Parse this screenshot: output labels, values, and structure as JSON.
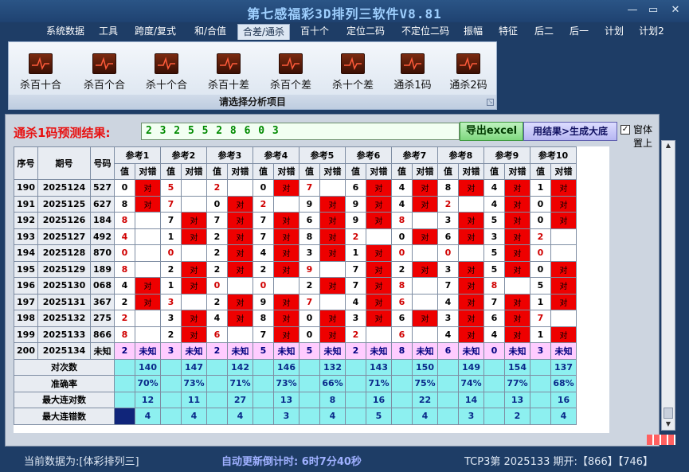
{
  "window": {
    "title": "第七感福彩3D排列三软件V8.81",
    "btn_min": "—",
    "btn_max": "▭",
    "btn_close": "✕"
  },
  "menu": [
    "系统数据",
    "工具",
    "跨度/复式",
    "和/合值",
    "合差/通杀",
    "百十个",
    "定位二码",
    "不定位二码",
    "振幅",
    "特征",
    "后二",
    "后一",
    "计划",
    "计划2"
  ],
  "ribbon": {
    "buttons": [
      "杀百十合",
      "杀百个合",
      "杀十个合",
      "杀百十差",
      "杀百个差",
      "杀十个差",
      "通杀1码",
      "通杀2码"
    ],
    "caption": "请选择分析项目"
  },
  "prediction": {
    "label": "通杀1码预测结果:",
    "value": "2 3 2 5 5 2 8 6 0 3",
    "excel_button": "导出excel",
    "generate_button": "用结果>生成大底",
    "pin_checkbox": "窗体置上",
    "pin_checked": true
  },
  "grid": {
    "h_seq": "序号",
    "h_period": "期号",
    "h_number": "号码",
    "refs": [
      "参考1",
      "参考2",
      "参考3",
      "参考4",
      "参考5",
      "参考6",
      "参考7",
      "参考8",
      "参考9",
      "参考10"
    ],
    "sub_value": "值",
    "sub_result": "对错",
    "ok_text": "对",
    "unknown_text": "未知",
    "rows": [
      {
        "seq": "190",
        "period": "2025124",
        "num": "527",
        "vals": [
          "0",
          "5",
          "2",
          "0",
          "7",
          "6",
          "4",
          "8",
          "4",
          "1"
        ],
        "ok": [
          1,
          0,
          0,
          1,
          0,
          1,
          1,
          1,
          1,
          1
        ],
        "red": [
          0,
          1,
          1,
          0,
          1,
          0,
          0,
          0,
          0,
          0
        ]
      },
      {
        "seq": "191",
        "period": "2025125",
        "num": "627",
        "vals": [
          "8",
          "7",
          "0",
          "2",
          "9",
          "9",
          "4",
          "2",
          "4",
          "0"
        ],
        "ok": [
          1,
          0,
          1,
          0,
          1,
          1,
          1,
          0,
          1,
          1
        ],
        "red": [
          0,
          1,
          0,
          1,
          0,
          0,
          0,
          1,
          0,
          0
        ]
      },
      {
        "seq": "192",
        "period": "2025126",
        "num": "184",
        "vals": [
          "8",
          "7",
          "7",
          "7",
          "6",
          "9",
          "8",
          "3",
          "5",
          "0"
        ],
        "ok": [
          0,
          1,
          1,
          1,
          1,
          1,
          0,
          1,
          1,
          1
        ],
        "red": [
          1,
          0,
          0,
          0,
          0,
          0,
          1,
          0,
          0,
          0
        ]
      },
      {
        "seq": "193",
        "period": "2025127",
        "num": "492",
        "vals": [
          "4",
          "1",
          "2",
          "7",
          "8",
          "2",
          "0",
          "6",
          "3",
          "2"
        ],
        "ok": [
          0,
          1,
          1,
          1,
          1,
          0,
          1,
          1,
          1,
          0
        ],
        "red": [
          1,
          0,
          0,
          0,
          0,
          1,
          0,
          0,
          0,
          1
        ]
      },
      {
        "seq": "194",
        "period": "2025128",
        "num": "870",
        "vals": [
          "0",
          "0",
          "2",
          "4",
          "3",
          "1",
          "0",
          "0",
          "5",
          "0"
        ],
        "ok": [
          0,
          0,
          1,
          1,
          1,
          1,
          0,
          0,
          1,
          0
        ],
        "red": [
          1,
          1,
          0,
          0,
          0,
          0,
          1,
          1,
          0,
          1
        ]
      },
      {
        "seq": "195",
        "period": "2025129",
        "num": "189",
        "vals": [
          "8",
          "2",
          "2",
          "2",
          "9",
          "7",
          "2",
          "3",
          "5",
          "0"
        ],
        "ok": [
          0,
          1,
          1,
          1,
          0,
          1,
          1,
          1,
          1,
          1
        ],
        "red": [
          1,
          0,
          0,
          0,
          1,
          0,
          0,
          0,
          0,
          0
        ]
      },
      {
        "seq": "196",
        "period": "2025130",
        "num": "068",
        "vals": [
          "4",
          "1",
          "0",
          "0",
          "2",
          "7",
          "8",
          "7",
          "8",
          "5"
        ],
        "ok": [
          1,
          1,
          0,
          0,
          1,
          1,
          0,
          1,
          0,
          1
        ],
        "red": [
          0,
          0,
          1,
          1,
          0,
          0,
          1,
          0,
          1,
          0
        ]
      },
      {
        "seq": "197",
        "period": "2025131",
        "num": "367",
        "vals": [
          "2",
          "3",
          "2",
          "9",
          "7",
          "4",
          "6",
          "4",
          "7",
          "1"
        ],
        "ok": [
          1,
          0,
          1,
          1,
          0,
          1,
          0,
          1,
          1,
          1
        ],
        "red": [
          0,
          1,
          0,
          0,
          1,
          0,
          1,
          0,
          0,
          0
        ]
      },
      {
        "seq": "198",
        "period": "2025132",
        "num": "275",
        "vals": [
          "2",
          "3",
          "4",
          "8",
          "0",
          "3",
          "6",
          "3",
          "6",
          "7"
        ],
        "ok": [
          0,
          1,
          1,
          1,
          1,
          1,
          1,
          1,
          1,
          0
        ],
        "red": [
          1,
          0,
          0,
          0,
          0,
          0,
          0,
          0,
          0,
          1
        ]
      },
      {
        "seq": "199",
        "period": "2025133",
        "num": "866",
        "vals": [
          "8",
          "2",
          "6",
          "7",
          "0",
          "2",
          "6",
          "4",
          "4",
          "1"
        ],
        "ok": [
          0,
          1,
          0,
          1,
          1,
          0,
          0,
          1,
          1,
          1
        ],
        "red": [
          1,
          0,
          1,
          0,
          0,
          1,
          1,
          0,
          0,
          0
        ]
      }
    ],
    "pred_row": {
      "seq": "200",
      "period": "2025134",
      "num": "未知",
      "vals": [
        "2",
        "3",
        "2",
        "5",
        "5",
        "2",
        "8",
        "6",
        "0",
        "3"
      ]
    },
    "stats": [
      {
        "label": "对次数",
        "vals": [
          "140",
          "147",
          "142",
          "146",
          "132",
          "143",
          "150",
          "149",
          "154",
          "137"
        ]
      },
      {
        "label": "准确率",
        "vals": [
          "70%",
          "73%",
          "71%",
          "73%",
          "66%",
          "71%",
          "75%",
          "74%",
          "77%",
          "68%"
        ]
      },
      {
        "label": "最大连对数",
        "vals": [
          "12",
          "11",
          "27",
          "13",
          "8",
          "16",
          "22",
          "14",
          "13",
          "16"
        ]
      },
      {
        "label": "最大连错数",
        "vals": [
          "4",
          "4",
          "4",
          "3",
          "4",
          "5",
          "4",
          "3",
          "2",
          "4"
        ]
      }
    ]
  },
  "status": {
    "current_data": "当前数据为:[体彩排列三]",
    "countdown": "自动更新倒计时: 6时7分40秒",
    "last_draw": "TCP3第 2025133 期开:【866】【746】"
  },
  "colors": {
    "hit_red": "#ee0000",
    "stat_cyan": "#8df0f0",
    "pred_pink": "#ffccff",
    "window_blue": "#1e3d66"
  }
}
